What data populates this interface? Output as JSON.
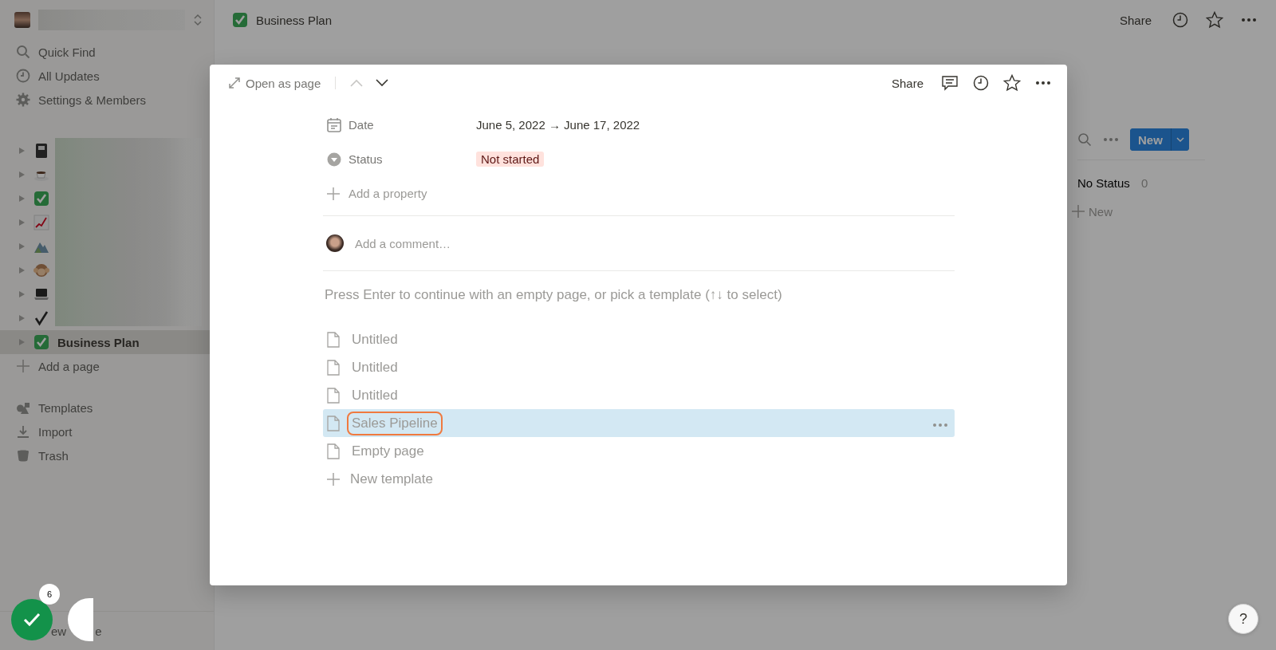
{
  "sidebar": {
    "nav": [
      "Quick Find",
      "All Updates",
      "Settings & Members"
    ],
    "pages": [
      {
        "selected": false
      },
      {
        "selected": false
      },
      {
        "selected": false
      },
      {
        "selected": false
      },
      {
        "selected": false
      },
      {
        "selected": false
      },
      {
        "selected": false
      },
      {
        "selected": false
      },
      {
        "label": "Business Plan",
        "selected": true
      }
    ],
    "add_page": "Add a page",
    "tools": [
      "Templates",
      "Import",
      "Trash"
    ],
    "bottom": [
      "ew",
      "e"
    ]
  },
  "topbar": {
    "title": "Business Plan",
    "share": "Share"
  },
  "board": {
    "new_button": "New",
    "group": {
      "label": "No Status",
      "count": "0"
    },
    "add": "New"
  },
  "modal": {
    "open_as_page": "Open as page",
    "share": "Share",
    "properties": [
      {
        "kind": "date",
        "name": "Date",
        "value": "June 5, 2022 → June 17, 2022"
      },
      {
        "kind": "status",
        "name": "Status",
        "value": "Not started",
        "color": "#ffe2dd"
      }
    ],
    "add_property": "Add a property",
    "comment_placeholder": "Add a comment…",
    "hint": "Press Enter to continue with an empty page, or pick a template (↑↓ to select)",
    "templates": [
      {
        "label": "Untitled",
        "selected": false,
        "annotated": false
      },
      {
        "label": "Untitled",
        "selected": false,
        "annotated": false
      },
      {
        "label": "Untitled",
        "selected": false,
        "annotated": false
      },
      {
        "label": "Sales Pipeline",
        "selected": true,
        "annotated": true
      },
      {
        "label": "Empty page",
        "selected": false,
        "annotated": false
      }
    ],
    "new_template": "New template"
  },
  "recorder": {
    "count": "6"
  },
  "help": "?"
}
